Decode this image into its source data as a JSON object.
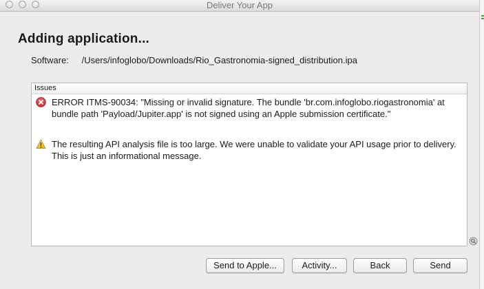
{
  "window": {
    "title": "Deliver Your App"
  },
  "heading": "Adding application...",
  "software": {
    "label": "Software:",
    "path": "/Users/infoglobo/Downloads/Rio_Gastronomia-signed_distribution.ipa"
  },
  "issues": {
    "header": "Issues",
    "items": [
      {
        "severity": "error",
        "icon": "error-icon",
        "text": "ERROR ITMS-90034: \"Missing or invalid signature. The bundle 'br.com.infoglobo.riogastronomia' at bundle path 'Payload/Jupiter.app' is not signed using an Apple submission certificate.\""
      },
      {
        "severity": "warning",
        "icon": "warning-icon",
        "text": "The resulting API analysis file is too large.  We were unable to validate your API usage prior to delivery.  This is just an informational message."
      }
    ]
  },
  "buttons": {
    "send_to_apple": "Send to Apple...",
    "activity": "Activity...",
    "back": "Back",
    "send": "Send"
  },
  "colors": {
    "error": "#d9353a",
    "warning": "#f2c230",
    "window_bg": "#ececec"
  }
}
